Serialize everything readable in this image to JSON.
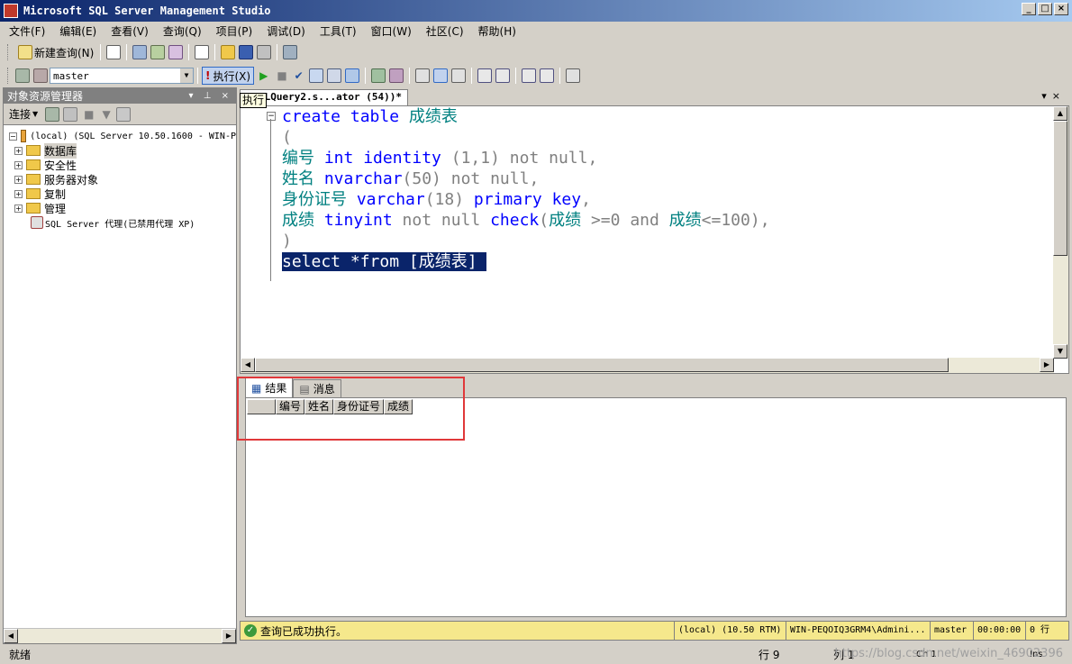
{
  "window": {
    "title": "Microsoft SQL Server Management Studio"
  },
  "menu": [
    "文件(F)",
    "编辑(E)",
    "查看(V)",
    "查询(Q)",
    "项目(P)",
    "调试(D)",
    "工具(T)",
    "窗口(W)",
    "社区(C)",
    "帮助(H)"
  ],
  "toolbar": {
    "new_query": "新建查询(N)",
    "database": "master",
    "execute": "执行(X)"
  },
  "object_explorer": {
    "title": "对象资源管理器",
    "connect": "连接",
    "server": "(local) (SQL Server 10.50.1600 - WIN-P",
    "nodes": [
      "数据库",
      "安全性",
      "服务器对象",
      "复制",
      "管理"
    ],
    "agent": "SQL Server 代理(已禁用代理 XP)"
  },
  "editor": {
    "tab_title": "QLQuery2.s...ator (54))*",
    "tooltip": "执行",
    "lines": [
      {
        "t1": "create table ",
        "t2": "成绩表"
      },
      {
        "t1": "("
      },
      {
        "name": "编号",
        "type": "int",
        "rest1": " identity",
        "rest2": " (1,1) ",
        "rest3": "not null",
        "rest4": ","
      },
      {
        "name": "姓名",
        "type": "nvarchar",
        "rest2": "(50) ",
        "rest3": "not null",
        "rest4": ","
      },
      {
        "name": "身份证号",
        "type": "varchar",
        "rest2": "(18) ",
        "rest5": "primary key",
        "rest4": ","
      },
      {
        "name": "成绩",
        "type": "tinyint",
        "rest3": " not null",
        "rest5": " check",
        "c1": "(",
        "c2": "成绩",
        "c3": " >=0 ",
        "c4": "and",
        "c5": " ",
        "c6": "成绩",
        "c7": "<=100),"
      },
      {
        "t1": ")"
      },
      {
        "t1": ""
      },
      {
        "sel": "select *from [成绩表] "
      }
    ]
  },
  "results": {
    "tabs": [
      "结果",
      "消息"
    ],
    "columns": [
      "编号",
      "姓名",
      "身份证号",
      "成绩"
    ]
  },
  "query_status": {
    "message": "查询已成功执行。",
    "server": "(local) (10.50 RTM)",
    "user": "WIN-PEQOIQ3GRM4\\Admini...",
    "db": "master",
    "time": "00:00:00",
    "rows": "0 行"
  },
  "statusbar": {
    "ready": "就绪",
    "line": "行 9",
    "col": "列 1",
    "ch": "Ch 1",
    "mode": "Ins",
    "watermark": "https://blog.csdn.net/weixin_46902396"
  }
}
